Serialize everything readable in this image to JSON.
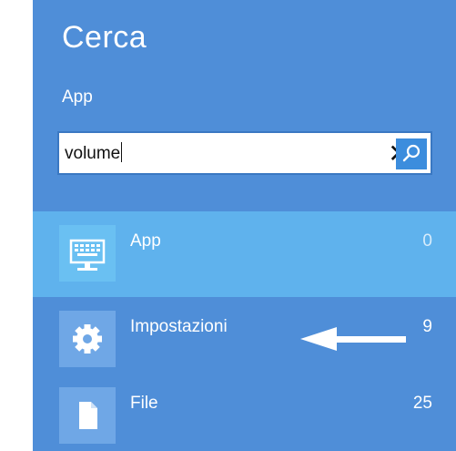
{
  "panel": {
    "title": "Cerca",
    "scope": "App"
  },
  "search": {
    "value": "volume",
    "clear_icon": "close-icon",
    "search_icon": "search-icon"
  },
  "results": [
    {
      "label": "App",
      "count": "0",
      "icon": "keyboard-monitor-icon",
      "selected": true
    },
    {
      "label": "Impostazioni",
      "count": "9",
      "icon": "gear-icon",
      "selected": false
    },
    {
      "label": "File",
      "count": "25",
      "icon": "file-icon",
      "selected": false
    }
  ],
  "annotation": {
    "icon": "arrow-left-icon"
  },
  "colors": {
    "panel_bg": "#4f8ed8",
    "selected_row": "#5fb2ed",
    "search_button": "#3c8ddd",
    "text": "#ffffff"
  }
}
